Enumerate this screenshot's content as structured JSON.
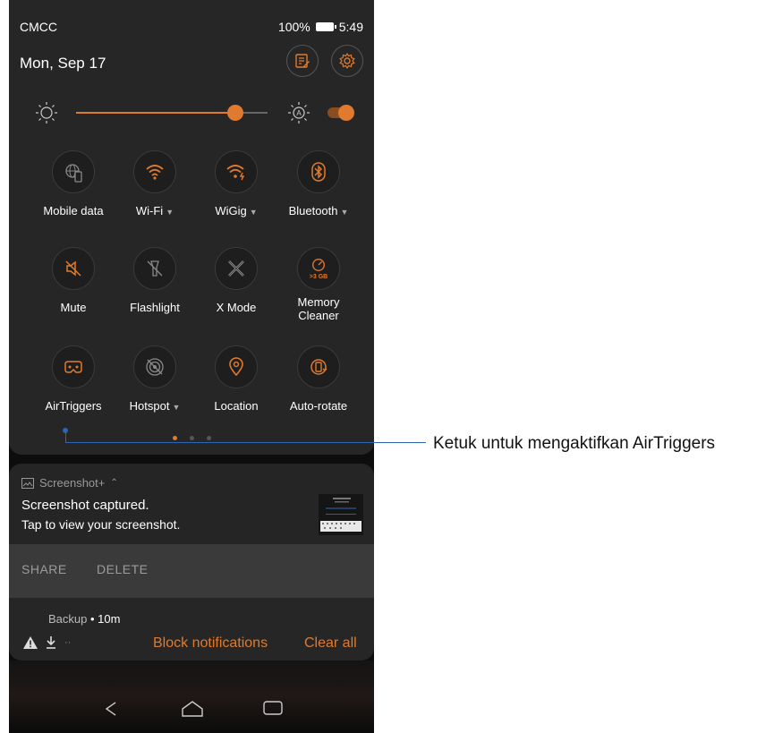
{
  "status": {
    "carrier": "CMCC",
    "battery": "100%",
    "time": "5:49"
  },
  "header": {
    "date": "Mon, Sep 17"
  },
  "brightness": {
    "level": 0.83,
    "auto": true
  },
  "tiles": [
    {
      "label": "Mobile data",
      "icon": "globe-phone-icon",
      "active": false,
      "caret": false
    },
    {
      "label": "Wi-Fi",
      "icon": "wifi-icon",
      "active": true,
      "caret": true
    },
    {
      "label": "WiGig",
      "icon": "wigig-icon",
      "active": true,
      "caret": true
    },
    {
      "label": "Bluetooth",
      "icon": "bluetooth-icon",
      "active": true,
      "caret": true
    },
    {
      "label": "Mute",
      "icon": "mute-icon",
      "active": true,
      "caret": false
    },
    {
      "label": "Flashlight",
      "icon": "flashlight-icon",
      "active": false,
      "caret": false
    },
    {
      "label": "X Mode",
      "icon": "x-mode-icon",
      "active": false,
      "caret": false
    },
    {
      "label": "Memory Cleaner",
      "icon": "memory-cleaner-icon",
      "active": true,
      "caret": false,
      "sub": ">3 GB"
    },
    {
      "label": "AirTriggers",
      "icon": "airtriggers-icon",
      "active": true,
      "caret": false
    },
    {
      "label": "Hotspot",
      "icon": "hotspot-icon",
      "active": false,
      "caret": true
    },
    {
      "label": "Location",
      "icon": "location-icon",
      "active": true,
      "caret": false
    },
    {
      "label": "Auto-rotate",
      "icon": "auto-rotate-icon",
      "active": true,
      "caret": false
    }
  ],
  "notification": {
    "app": "Screenshot+",
    "title": "Screenshot captured.",
    "text": "Tap to view your screenshot.",
    "actions": [
      "SHARE",
      "DELETE"
    ]
  },
  "notification2": {
    "app": "Backup",
    "age": "10m",
    "block_label": "Block notifications",
    "clear_label": "Clear all"
  },
  "callout": {
    "text": "Ketuk untuk mengaktifkan AirTriggers"
  },
  "colors": {
    "accent": "#e07a2e",
    "callout": "#2a66b3",
    "panel": "#262626"
  }
}
